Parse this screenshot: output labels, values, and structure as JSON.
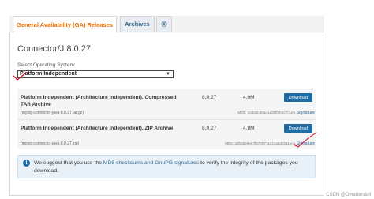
{
  "tabs": {
    "ga": "General Availability (GA) Releases",
    "archives": "Archives",
    "more": "Ⓧ"
  },
  "title": "Connector/J 8.0.27",
  "os": {
    "label": "Select Operating System:",
    "selected": "Platform Independent"
  },
  "rows": [
    {
      "name": "Platform Independent (Architecture Independent), Compressed TAR Archive",
      "file": "(mysql-connector-java-8.0.27.tar.gz)",
      "version": "8.0.27",
      "size": "4.0M",
      "button": "Download",
      "md5": "MD5: 10d3dc26ad1a39f0fb2c7c1eb...",
      "signature": "Signature"
    },
    {
      "name": "Platform Independent (Architecture Independent), ZIP Archive",
      "file": "(mysql-connector-java-8.0.27.zip)",
      "version": "8.0.27",
      "size": "4.8M",
      "button": "Download",
      "md5": "MD5: 3db5be9e97f8700731c1cadd0211eca...",
      "signature": "Signature"
    }
  ],
  "notice": {
    "before": "We suggest that you use the ",
    "link": "MD5 checksums and GnuPG signatures",
    "after": " to verify the integrity of the packages you download."
  },
  "watermark": "CSDN @Dmatterstall",
  "colors": {
    "accent": "#e76f00",
    "button": "#1f6ca3",
    "link": "#346a93",
    "annotation": "#d0021b"
  }
}
